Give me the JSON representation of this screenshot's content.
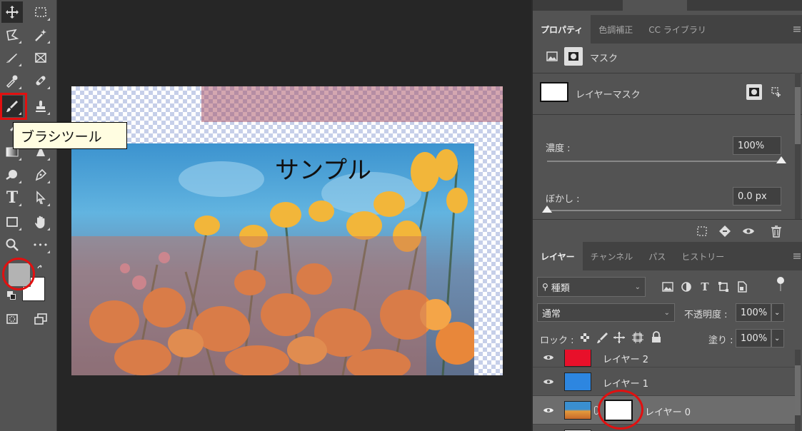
{
  "tooltip": {
    "text": "ブラシツール"
  },
  "tools": [
    {
      "name": "move-tool",
      "icon": "move-icon"
    },
    {
      "name": "marquee-tool",
      "icon": "marquee-icon"
    },
    {
      "name": "lasso-tool",
      "icon": "lasso-icon"
    },
    {
      "name": "magic-wand-tool",
      "icon": "magic-wand-icon"
    },
    {
      "name": "crop-tool",
      "icon": "crop-icon"
    },
    {
      "name": "frame-tool",
      "icon": "frame-icon"
    },
    {
      "name": "eyedropper-tool",
      "icon": "eyedropper-icon"
    },
    {
      "name": "healing-brush-tool",
      "icon": "bandage-icon"
    },
    {
      "name": "brush-tool",
      "icon": "brush-icon"
    },
    {
      "name": "stamp-tool",
      "icon": "stamp-icon"
    },
    {
      "name": "history-brush-tool",
      "icon": "history-brush-icon"
    },
    {
      "name": "eraser-tool",
      "icon": "eraser-icon"
    },
    {
      "name": "gradient-tool",
      "icon": "gradient-icon"
    },
    {
      "name": "blur-tool",
      "icon": "blur-icon"
    },
    {
      "name": "dodge-tool",
      "icon": "dodge-icon"
    },
    {
      "name": "pen-tool",
      "icon": "pen-icon"
    },
    {
      "name": "type-tool",
      "icon": "type-icon",
      "glyph": "T"
    },
    {
      "name": "path-selection-tool",
      "icon": "arrow-icon"
    },
    {
      "name": "rectangle-tool",
      "icon": "rectangle-icon"
    },
    {
      "name": "hand-tool",
      "icon": "hand-icon"
    },
    {
      "name": "zoom-tool",
      "icon": "zoom-icon"
    },
    {
      "name": "more-tools",
      "icon": "ellipsis-icon",
      "glyph": "•••"
    }
  ],
  "colors": {
    "foreground": "#b3b3b3",
    "background": "#ffffff",
    "highlight_red": "#e01010"
  },
  "canvas": {
    "text": "サンプル"
  },
  "properties_panel": {
    "tabs": [
      "プロパティ",
      "色調補正",
      "CC ライブラリ"
    ],
    "mask_header": "マスク",
    "layer_mask_label": "レイヤーマスク",
    "density_label": "濃度 :",
    "density_value": "100%",
    "density_level": 1.0,
    "feather_label": "ぼかし :",
    "feather_value": "0.0 px",
    "feather_level": 0.0
  },
  "layers_panel": {
    "tabs": [
      "レイヤー",
      "チャンネル",
      "パス",
      "ヒストリー"
    ],
    "filter_kind": "種類",
    "blend_mode": "通常",
    "opacity_label": "不透明度 :",
    "opacity_value": "100%",
    "lock_label": "ロック :",
    "fill_label": "塗り :",
    "fill_value": "100%",
    "layers": [
      {
        "name": "レイヤー 2",
        "thumb_color": "#e8102a"
      },
      {
        "name": "レイヤー 1",
        "thumb_color": "#2d86e0"
      },
      {
        "name": "レイヤー 0",
        "thumb_color": "#e39a3c"
      }
    ]
  }
}
